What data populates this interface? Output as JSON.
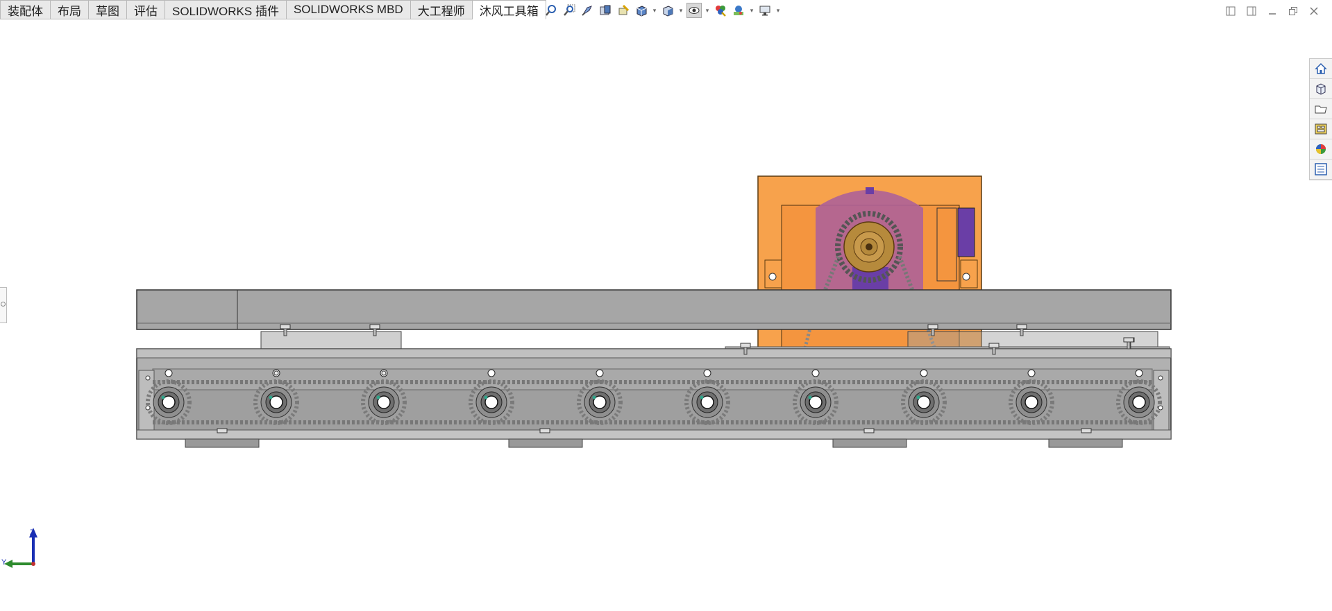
{
  "tabs": [
    {
      "label": "装配体"
    },
    {
      "label": "布局"
    },
    {
      "label": "草图"
    },
    {
      "label": "评估"
    },
    {
      "label": "SOLIDWORKS 插件"
    },
    {
      "label": "SOLIDWORKS MBD"
    },
    {
      "label": "大工程师"
    },
    {
      "label": "沐风工具箱"
    }
  ],
  "active_tab": "沐风工具箱",
  "heads_up_toolbar": [
    {
      "icon": "zoom-to-fit-icon"
    },
    {
      "icon": "zoom-to-area-icon"
    },
    {
      "icon": "previous-view-icon"
    },
    {
      "icon": "section-view-icon"
    },
    {
      "icon": "dynamic-annotation-views-icon"
    },
    {
      "icon": "view-orientation-icon"
    },
    {
      "icon": "display-style-icon"
    },
    {
      "icon": "hide-show-items-icon"
    },
    {
      "icon": "edit-appearance-icon"
    },
    {
      "icon": "apply-scene-icon"
    },
    {
      "icon": "view-settings-icon"
    }
  ],
  "window_controls": [
    "tile-left-icon",
    "tile-right-icon",
    "minimize-icon",
    "restore-icon",
    "close-icon"
  ],
  "task_pane": [
    {
      "icon": "solidworks-resources-icon"
    },
    {
      "icon": "design-library-icon"
    },
    {
      "icon": "file-explorer-icon"
    },
    {
      "icon": "view-palette-icon"
    },
    {
      "icon": "appearances-scenes-icon"
    },
    {
      "icon": "custom-properties-icon"
    }
  ],
  "triad": {
    "z_label": "Z",
    "y_label": "Y"
  },
  "colors": {
    "housing": "#f7a24c",
    "motor": "#7d4fb0",
    "steel": "#a6a6a6",
    "steel_dark": "#8f8f8f",
    "sprocket": "#b68a3c",
    "axis_z": "#1a2fb4",
    "axis_y": "#2e8b2e"
  }
}
